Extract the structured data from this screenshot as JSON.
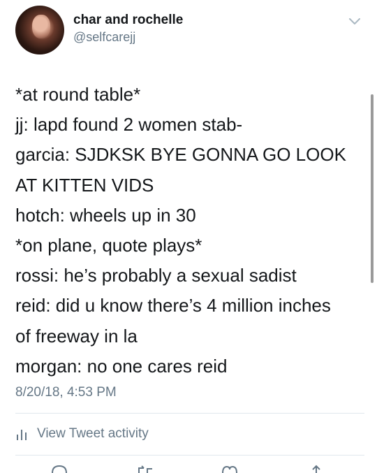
{
  "tweet": {
    "author_name": "char and rochelle",
    "author_handle": "@selfcarejj",
    "lines": [
      "*at round table*",
      "jj: lapd found 2 women stab-",
      "garcia: SJDKSK BYE GONNA GO LOOK",
      "AT KITTEN VIDS",
      "hotch: wheels up in 30",
      "*on plane, quote plays*",
      "rossi: he’s probably a sexual sadist",
      "reid: did u know there’s 4 million inches",
      "of freeway in la",
      "morgan: no one cares reid"
    ],
    "timestamp": "8/20/18, 4:53 PM"
  },
  "activity": {
    "label": "View Tweet activity",
    "icon": "bar-chart-icon"
  },
  "actions": [
    {
      "icon": "reply-icon"
    },
    {
      "icon": "retweet-icon"
    },
    {
      "icon": "heart-icon"
    },
    {
      "icon": "share-icon"
    }
  ],
  "colors": {
    "text": "#14171a",
    "secondary": "#657786",
    "divider": "#e1e8ed",
    "accent": "#1da1f2"
  }
}
